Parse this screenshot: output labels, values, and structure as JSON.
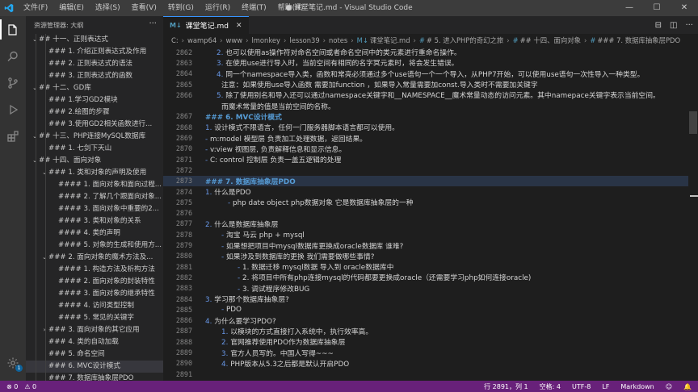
{
  "window": {
    "title": "● 课堂笔记.md - Visual Studio Code",
    "menu": [
      "文件(F)",
      "编辑(E)",
      "选择(S)",
      "查看(V)",
      "转到(G)",
      "运行(R)",
      "终端(T)",
      "帮助(H)"
    ],
    "controls": [
      "—",
      "☐",
      "✕"
    ]
  },
  "sidebar": {
    "header": "资源管理器: 大纲",
    "more": "···",
    "items": [
      {
        "label": "## 十一、正则表达式",
        "level": 1,
        "chevron": "v"
      },
      {
        "label": "### 1. 介绍正则表达式及作用",
        "level": 2,
        "chevron": ""
      },
      {
        "label": "### 2. 正则表达式的语法",
        "level": 2,
        "chevron": ""
      },
      {
        "label": "### 3. 正则表达式的函数",
        "level": 2,
        "chevron": ""
      },
      {
        "label": "## 十二、GD库",
        "level": 1,
        "chevron": "v"
      },
      {
        "label": "### 1.学习GD2模块",
        "level": 2,
        "chevron": ""
      },
      {
        "label": "### 2.绘图的步骤",
        "level": 2,
        "chevron": ""
      },
      {
        "label": "### 3.使用GD2相关函数进行...",
        "level": 2,
        "chevron": ""
      },
      {
        "label": "## 十三、PHP连接MySQL数据库",
        "level": 1,
        "chevron": "v"
      },
      {
        "label": "### 1. 七剑下天山",
        "level": 2,
        "chevron": ""
      },
      {
        "label": "## 十四、面向对象",
        "level": 1,
        "chevron": "v"
      },
      {
        "label": "### 1. 类和对象的声明及使用",
        "level": 2,
        "chevron": "v"
      },
      {
        "label": "#### 1. 面向对象和面向过程...",
        "level": 3,
        "chevron": ""
      },
      {
        "label": "#### 2. 了解几个跟面向对象...",
        "level": 3,
        "chevron": ""
      },
      {
        "label": "#### 3. 面向对象中重要的2...",
        "level": 3,
        "chevron": ""
      },
      {
        "label": "#### 3. 类和对象的关系",
        "level": 3,
        "chevron": ""
      },
      {
        "label": "#### 4. 类的声明",
        "level": 3,
        "chevron": ""
      },
      {
        "label": "#### 5. 对象的生成和使用方...",
        "level": 3,
        "chevron": ""
      },
      {
        "label": "### 2. 面向对象的魔术方法及...",
        "level": 2,
        "chevron": "v"
      },
      {
        "label": "#### 1. 构造方法及析构方法",
        "level": 3,
        "chevron": ""
      },
      {
        "label": "#### 2. 面向对象的封装特性",
        "level": 3,
        "chevron": ""
      },
      {
        "label": "#### 3. 面向对象的继承特性",
        "level": 3,
        "chevron": ""
      },
      {
        "label": "#### 4. 访问类型控制",
        "level": 3,
        "chevron": ""
      },
      {
        "label": "#### 5. 常见的关键字",
        "level": 3,
        "chevron": ""
      },
      {
        "label": "### 3. 面向对象的其它应用",
        "level": 2,
        "chevron": ">"
      },
      {
        "label": "### 4. 类的自动加载",
        "level": 2,
        "chevron": ""
      },
      {
        "label": "### 5. 命名空间",
        "level": 2,
        "chevron": ""
      },
      {
        "label": "### 6. MVC设计模式",
        "level": 2,
        "chevron": "",
        "selected": true
      },
      {
        "label": "### 7. 数据库抽象层PDO",
        "level": 2,
        "chevron": ""
      }
    ]
  },
  "tab": {
    "icon": "M↓",
    "label": "课堂笔记.md",
    "close": "✕"
  },
  "breadcrumb": [
    {
      "text": "C:"
    },
    {
      "text": "wamp64"
    },
    {
      "text": "www"
    },
    {
      "text": "lmonkey"
    },
    {
      "text": "lesson39"
    },
    {
      "text": "notes"
    },
    {
      "text": "课堂笔记.md",
      "icon": "M↓"
    },
    {
      "text": "# 5. 进入PHP的奇幻之旅",
      "icon": "#"
    },
    {
      "text": "## 十四、面向对象",
      "icon": "#"
    },
    {
      "text": "### 7. 数据库抽象层PDO",
      "icon": "#"
    }
  ],
  "editor": {
    "lines": [
      {
        "n": "2862",
        "indent": 66,
        "text": "2. 也可以使用as操作符对命名空间或者命名空间中的类元素进行重命名操作。"
      },
      {
        "n": "2863",
        "indent": 66,
        "text": "3. 在使用use进行导入时，当前空间有相同的名字冥元素时，将会发生错误。"
      },
      {
        "n": "2864",
        "indent": 66,
        "text": "4. 同一个namespace导入类，函数和常亮必须通过多个use语句一个一个导入，从PHP7开始，可以使用use语句一次性导入一种类型。"
      },
      {
        "n": "2865",
        "indent": 72,
        "text": "注意：如果使用use导入函数 需要加function ，如果导入常量需要加const.导入类时不需要加关键字"
      },
      {
        "n": "2866",
        "indent": 66,
        "text": "5. 除了使用别名和导入还可以通过namespace关键字和__NAMESPACE__魔术常量动态的访问元素。其中namepace关键字表示当前空间。"
      },
      {
        "n": "",
        "indent": 72,
        "text": "而魔术常量的值是当前空间的名称。"
      },
      {
        "n": "2867",
        "indent": 52,
        "text": "### 6. MVC设计模式",
        "heading": true
      },
      {
        "n": "2868",
        "indent": 52,
        "text": "1. 设计模式不限语言，任何一门服务器脚本语言都可以使用。"
      },
      {
        "n": "2869",
        "indent": 52,
        "text": "- m:model 模型层 负责加工处理数据，返回结果。"
      },
      {
        "n": "2870",
        "indent": 52,
        "text": "- v:view 视图层, 负责解释信息和显示信息。"
      },
      {
        "n": "2871",
        "indent": 52,
        "text": "- C: control 控制层  负责一盖五逻辑的处理"
      },
      {
        "n": "2872",
        "indent": 52,
        "text": ""
      },
      {
        "n": "2873",
        "indent": 52,
        "text": "### 7. 数据库抽象层PDO",
        "heading": true,
        "hl": true
      },
      {
        "n": "2874",
        "indent": 52,
        "text": "1. 什么是PDO"
      },
      {
        "n": "2875",
        "indent": 80,
        "text": "- php date object php数据对象 它是数据库抽象层的一种"
      },
      {
        "n": "2876",
        "indent": 52,
        "text": ""
      },
      {
        "n": "2877",
        "indent": 52,
        "text": "2. 什么是数据库抽象层"
      },
      {
        "n": "2878",
        "indent": 72,
        "text": "- 淘宝   马云 php + mysql"
      },
      {
        "n": "2879",
        "indent": 72,
        "text": "- 如果想把项目中mysql数据库更换成oracle数据库 谁难?"
      },
      {
        "n": "2880",
        "indent": 72,
        "text": "- 如果涉及到数据库的更换 我们需要做哪些事情?"
      },
      {
        "n": "2881",
        "indent": 92,
        "text": "- 1. 数据迁移 mysql数据 导入到 oracle数据库中"
      },
      {
        "n": "2882",
        "indent": 92,
        "text": "- 2. 将项目中所有php连接mysql的代码都要更换成oracle（还需要学习php如何连接oracle)"
      },
      {
        "n": "2883",
        "indent": 92,
        "text": "- 3. 调试程序修改BUG"
      },
      {
        "n": "2884",
        "indent": 52,
        "text": "3. 学习那个数据库抽象层?"
      },
      {
        "n": "2885",
        "indent": 72,
        "text": "- PDO"
      },
      {
        "n": "2886",
        "indent": 52,
        "text": "4. 为什么要学习PDO?"
      },
      {
        "n": "2887",
        "indent": 72,
        "text": "1. 以模块的方式直接打入系统中，执行效率高。"
      },
      {
        "n": "2888",
        "indent": 72,
        "text": "2. 官网推荐使用PDO作为数据库抽象层"
      },
      {
        "n": "2889",
        "indent": 72,
        "text": "3. 官方人员写的。中国人写得~~~"
      },
      {
        "n": "2890",
        "indent": 72,
        "text": "4. PHP版本从5.3之后都是默认开启PDO"
      },
      {
        "n": "2891",
        "indent": 52,
        "text": ""
      }
    ]
  },
  "statusbar": {
    "errors": "⊗ 0",
    "warnings": "⚠ 0",
    "position": "行 2891，列 1",
    "spaces": "空格: 4",
    "encoding": "UTF-8",
    "eol": "LF",
    "language": "Markdown",
    "color": "#68217a"
  },
  "activity_icons": [
    "explorer-icon",
    "search-icon",
    "source-control-icon",
    "debug-icon",
    "extensions-icon",
    "settings-icon"
  ]
}
